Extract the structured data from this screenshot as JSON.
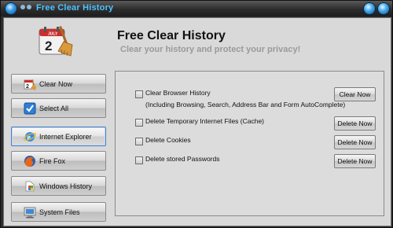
{
  "window": {
    "title": "Free Clear History"
  },
  "header": {
    "title": "Free Clear History",
    "subtitle": "Clear your history and protect your privacy!",
    "logo_text": "JULY",
    "logo_day": "2"
  },
  "sidebar": {
    "items": [
      {
        "label": "Clear Now",
        "icon": "calendar-broom-icon"
      },
      {
        "label": "Select All",
        "icon": "checkmark-icon"
      },
      {
        "label": "Internet Explorer",
        "icon": "internet-explorer-icon",
        "active": true
      },
      {
        "label": "Fire Fox",
        "icon": "firefox-icon"
      },
      {
        "label": "Windows History",
        "icon": "windows-history-icon"
      },
      {
        "label": "System Files",
        "icon": "system-files-icon"
      }
    ]
  },
  "options": [
    {
      "label": "Clear Browser History",
      "sublabel": "(Including Browsing, Search, Address Bar and Form AutoComplete)",
      "button": "Clear Now",
      "checked": false
    },
    {
      "label": "Delete Temporary Internet Files (Cache)",
      "button": "Delete Now",
      "checked": false
    },
    {
      "label": "Delete Cookies",
      "button": "Delete Now",
      "checked": false
    },
    {
      "label": "Delete stored Passwords",
      "button": "Delete Now",
      "checked": false
    }
  ],
  "colors": {
    "title_accent": "#4fc3ff",
    "subtitle": "#9a9a9a",
    "client_bg": "#d9d9d9"
  }
}
